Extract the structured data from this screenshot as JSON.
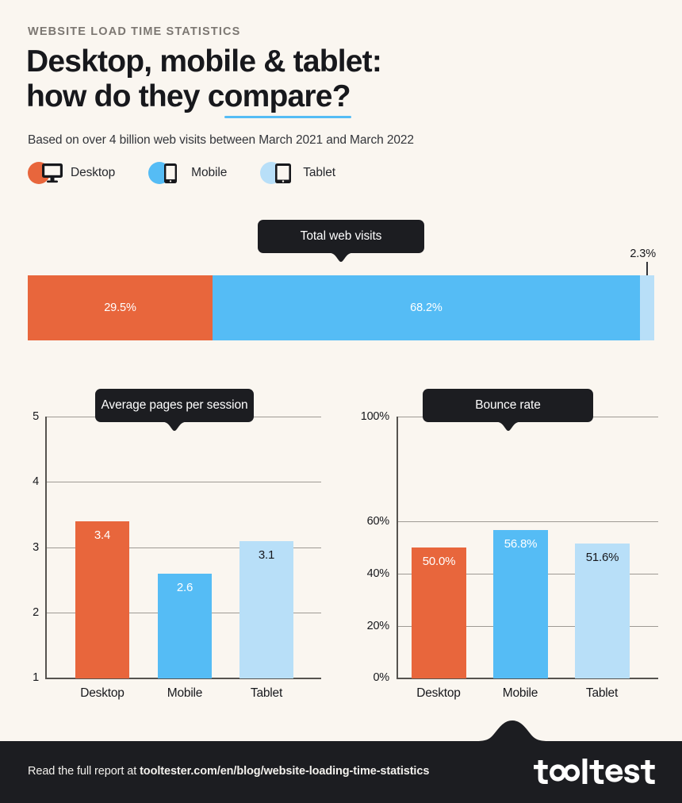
{
  "header": {
    "eyebrow": "WEBSITE LOAD TIME STATISTICS",
    "title_line1": "Desktop, mobile & tablet:",
    "title_line2": "how do they compare?",
    "subhead": "Based on over 4 billion web visits between March 2021 and March 2022"
  },
  "legend": {
    "items": [
      {
        "label": "Desktop",
        "icon": "monitor-icon",
        "color": "#e8663c"
      },
      {
        "label": "Mobile",
        "icon": "smartphone-icon",
        "color": "#55bcf5"
      },
      {
        "label": "Tablet",
        "icon": "tablet-icon",
        "color": "#b8dff8"
      }
    ]
  },
  "callouts": {
    "total_visits": "Total web visits",
    "pages_per_session": "Average pages per session",
    "bounce_rate": "Bounce rate"
  },
  "footer": {
    "lead": "Read the full report at ",
    "url": "tooltester.com/en/blog/website-loading-time-statistics",
    "logo": "tooltester"
  },
  "colors": {
    "background": "#faf6f0",
    "desktop": "#e8663c",
    "mobile": "#55bcf5",
    "tablet": "#b8dff8",
    "dark": "#1c1d21",
    "accent_underline": "#55bcf5"
  },
  "chart_data": [
    {
      "type": "bar",
      "title": "Total web visits",
      "stacked": true,
      "orientation": "horizontal",
      "categories": [
        "Desktop",
        "Mobile",
        "Tablet"
      ],
      "values": [
        29.5,
        68.2,
        2.3
      ],
      "labels": [
        "29.5%",
        "68.2%",
        "2.3%"
      ],
      "label_placement": [
        "inside",
        "inside",
        "outside"
      ],
      "unit": "%",
      "xlabel": "",
      "ylabel": "",
      "grid": false,
      "legend_position": "top"
    },
    {
      "type": "bar",
      "title": "Average pages per session",
      "categories": [
        "Desktop",
        "Mobile",
        "Tablet"
      ],
      "values": [
        3.4,
        2.6,
        3.1
      ],
      "labels": [
        "3.4",
        "2.6",
        "3.1"
      ],
      "ticks": [
        "5",
        "4",
        "3",
        "2",
        "1"
      ],
      "tick_values": [
        5,
        4,
        3,
        2,
        1
      ],
      "ylim": [
        1,
        5
      ],
      "xlabel": "",
      "ylabel": "",
      "grid": true
    },
    {
      "type": "bar",
      "title": "Bounce rate",
      "categories": [
        "Desktop",
        "Mobile",
        "Tablet"
      ],
      "values": [
        50.0,
        56.8,
        51.6
      ],
      "labels": [
        "50.0%",
        "56.8%",
        "51.6%"
      ],
      "ticks": [
        "100%",
        "60%",
        "40%",
        "20%",
        "0%"
      ],
      "tick_values": [
        100,
        60,
        40,
        20,
        0
      ],
      "ylim": [
        0,
        100
      ],
      "unit": "%",
      "xlabel": "",
      "ylabel": "",
      "grid": true
    }
  ]
}
